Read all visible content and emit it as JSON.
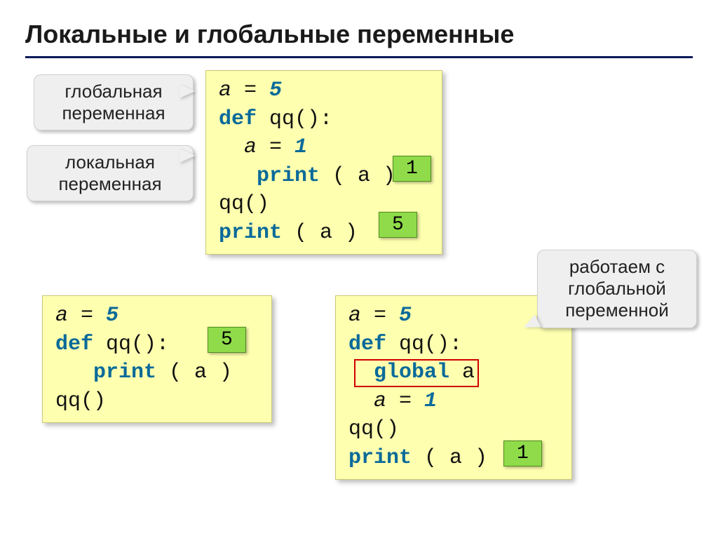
{
  "title": "Локальные и глобальные переменные",
  "callouts": {
    "global_var": "глобальная\nпеременная",
    "local_var": "локальная\nпеременная",
    "work_global": "работаем с\nглобальной\nпеременной"
  },
  "code": {
    "box1": {
      "l1_a": "a",
      "l1_eq": " = ",
      "l1_v": "5",
      "l2_def": "def",
      "l2_rest": " qq():",
      "l3_a": "  a",
      "l3_eq": " = ",
      "l3_v": "1",
      "l4_pr": "   print",
      "l4_rest": " ( a )",
      "l5": "qq()",
      "l6_pr": "print",
      "l6_rest": " ( a )"
    },
    "box2": {
      "l1_a": "a",
      "l1_eq": " = ",
      "l1_v": "5",
      "l2_def": "def",
      "l2_rest": " qq():",
      "l3_pr": "   print",
      "l3_rest": " ( a )",
      "l4": "qq()"
    },
    "box3": {
      "l1_a": "a",
      "l1_eq": " = ",
      "l1_v": "5",
      "l2_def": "def",
      "l2_rest": " qq():",
      "l3_gl": "  global",
      "l3_rest": " a",
      "l4_a": "  a",
      "l4_eq": " = ",
      "l4_v": "1",
      "l5": "qq()",
      "l6_pr": "print",
      "l6_rest": " ( a )"
    }
  },
  "chips": {
    "box1_inner": "1",
    "box1_outer": "5",
    "box2": "5",
    "box3": "1"
  }
}
